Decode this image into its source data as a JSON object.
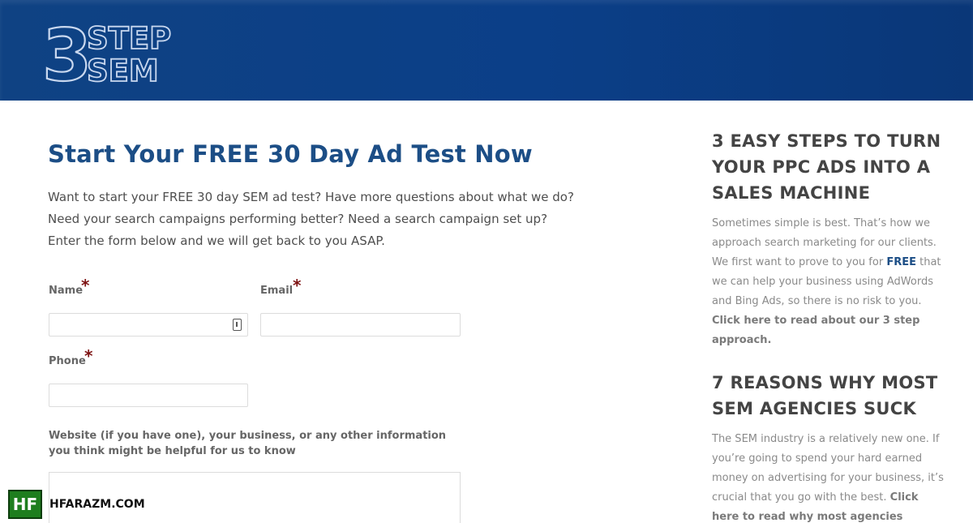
{
  "header": {
    "logo": {
      "digit": "3",
      "line1": "STEP",
      "line2": "SEM"
    }
  },
  "main": {
    "title": "Start Your FREE 30 Day Ad Test Now",
    "intro": "Want to start your FREE 30 day SEM ad test? Have more questions about what we do? Need your search campaigns performing better? Need a search campaign set up? Enter the form below and we will get back to you ASAP.",
    "form": {
      "name_label": "Name",
      "email_label": "Email",
      "phone_label": "Phone",
      "required_mark": "*",
      "website_label": "Website (if you have one), your business, or any other information you think might be helpful for us to know",
      "name_value": "",
      "email_value": "",
      "phone_value": ""
    }
  },
  "sidebar": {
    "section1": {
      "heading": "3 EASY STEPS TO TURN YOUR PPC ADS INTO A SALES MACHINE",
      "text_before": "Sometimes simple is best. That’s how we approach search marketing for our clients. We first want to prove to you for ",
      "free": "FREE",
      "text_after": " that we can help your business using AdWords and Bing Ads, so there is no risk to you. ",
      "link": "Click here to read about our 3 step approach."
    },
    "section2": {
      "heading": "7 REASONS WHY MOST SEM AGENCIES SUCK",
      "text": "The SEM industry is a relatively new one. If you’re going to spend your hard earned money on advertising for your business, it’s crucial that you go with the best. ",
      "link": "Click here to read why most agencies"
    }
  },
  "watermark": {
    "badge": "HF",
    "text": "HFARAZM.COM"
  },
  "colors": {
    "header": "#0b3f88",
    "title": "#1c4e86",
    "required": "#7d1212",
    "watermark": "#1e7e1e"
  }
}
